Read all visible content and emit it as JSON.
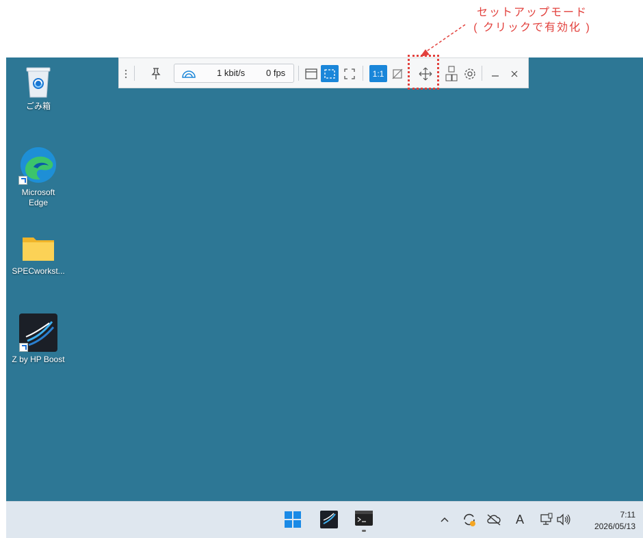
{
  "annotation": {
    "line1": "セットアップモード",
    "line2": "( クリックで有効化 )",
    "color": "#e2403c"
  },
  "desktop": {
    "background": "#2d7795",
    "icons": [
      {
        "label": "ごみ箱",
        "icon": "recycle-bin-icon"
      },
      {
        "label_line1": "Microsoft",
        "label_line2": "Edge",
        "icon": "edge-icon",
        "shortcut": true
      },
      {
        "label": "SPECworkst...",
        "icon": "folder-icon"
      },
      {
        "label": "Z by HP Boost",
        "icon": "z-by-hp-boost-icon",
        "shortcut": true
      }
    ]
  },
  "toolbar": {
    "bandwidth": "1 kbit/s",
    "fps": "0 fps",
    "ratio_label": "1:1",
    "buttons": [
      "drag-handle-icon",
      "pin-icon",
      "connection-speed-icon",
      "window-mode-icon",
      "fit-screen-icon",
      "fullscreen-icon",
      "actual-size-button",
      "no-scale-icon",
      "move-setup-icon",
      "keyboard-layout-icon",
      "settings-icon",
      "minimize-icon",
      "close-icon"
    ],
    "accent": "#1a86d9"
  },
  "taskbar": {
    "apps": [
      "start-button",
      "z-by-hp-boost-taskbar-icon",
      "terminal-taskbar-icon"
    ],
    "tray": [
      "chevron-up-icon",
      "sync-icon",
      "cloud-off-icon",
      "ime-icon",
      "network-icon",
      "volume-icon"
    ],
    "ime_label": "A",
    "time": "7:11",
    "date": "2026/05/13"
  }
}
